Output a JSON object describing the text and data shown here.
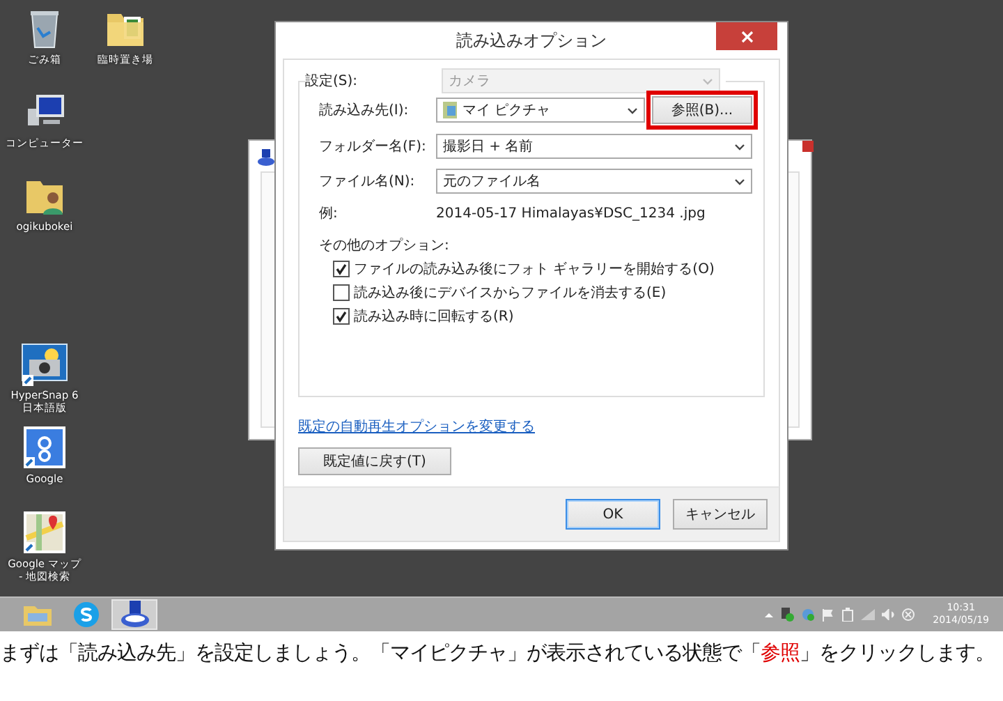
{
  "desktop_icons": [
    {
      "kind": "trash",
      "label": "ごみ箱"
    },
    {
      "kind": "folder",
      "label": "臨時置き場"
    },
    {
      "kind": "computer",
      "label": "コンピューター"
    },
    {
      "kind": "userfolder",
      "label": "ogikubokei"
    },
    {
      "kind": "camera",
      "label": "HyperSnap 6 日本語版"
    },
    {
      "kind": "google",
      "label": "Google"
    },
    {
      "kind": "map",
      "label": "Google マップ - 地図検索"
    }
  ],
  "dialog": {
    "title": "読み込みオプション",
    "settings": {
      "label": "設定(S):",
      "value": "カメラ",
      "disabled": true
    },
    "destination": {
      "label": "読み込み先(I):",
      "value": "マイ ピクチャ",
      "browse_button": "参照(B)...",
      "highlighted": true
    },
    "folder_name": {
      "label": "フォルダー名(F):",
      "value": "撮影日 + 名前"
    },
    "file_name": {
      "label": "ファイル名(N):",
      "value": "元のファイル名"
    },
    "example": {
      "label": "例:",
      "value": "2014-05-17 Himalayas¥DSC_1234 .jpg"
    },
    "other_options": {
      "label": "その他のオプション:",
      "checkboxes": [
        {
          "label": "ファイルの読み込み後にフォト ギャラリーを開始する(O)",
          "checked": true
        },
        {
          "label": "読み込み後にデバイスからファイルを消去する(E)",
          "checked": false
        },
        {
          "label": "読み込み時に回転する(R)",
          "checked": true
        }
      ]
    },
    "link": "既定の自動再生オプションを変更する",
    "reset_button": "既定値に戻す(T)",
    "buttons": [
      {
        "label": "OK",
        "default": true
      },
      {
        "label": "キャンセル",
        "default": false
      }
    ]
  },
  "taskbar": {
    "apps": [
      {
        "kind": "explorer",
        "selected": false
      },
      {
        "kind": "skype",
        "selected": false
      },
      {
        "kind": "scanner",
        "selected": true
      }
    ],
    "clock": {
      "time": "10:31",
      "date": "2014/05/19"
    }
  },
  "caption": "まずは「読み込み先」を設定しましょう。「マイピクチャ」が表示されている状態で「**参照**」をクリックします。"
}
